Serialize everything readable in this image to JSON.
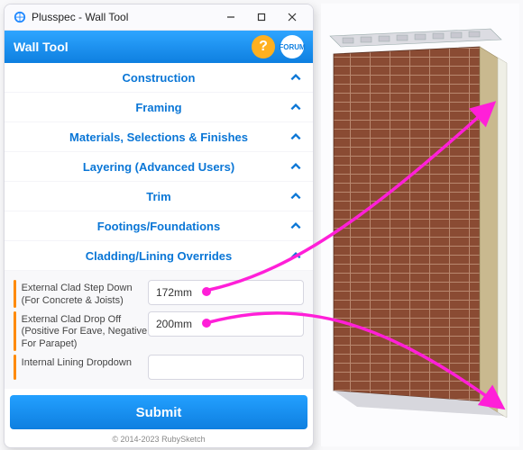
{
  "window": {
    "title": "Plusspec - Wall Tool"
  },
  "toolbar": {
    "title": "Wall Tool",
    "help_glyph": "?",
    "forum_label": "FORUM"
  },
  "sections": [
    {
      "label": "Construction"
    },
    {
      "label": "Framing"
    },
    {
      "label": "Materials, Selections & Finishes"
    },
    {
      "label": "Layering (Advanced Users)"
    },
    {
      "label": "Trim"
    },
    {
      "label": "Footings/Foundations"
    },
    {
      "label": "Cladding/Lining Overrides"
    }
  ],
  "overrides": {
    "step_down": {
      "label": "External Clad Step Down (For Concrete & Joists)",
      "value": "172mm"
    },
    "drop_off": {
      "label": "External Clad Drop Off (Positive For Eave, Negative For Parapet)",
      "value": "200mm"
    },
    "internal_lining": {
      "label": "Internal Lining Dropdown",
      "value": ""
    }
  },
  "submit": {
    "label": "Submit"
  },
  "footer": {
    "copyright": "© 2014-2023 RubySketch"
  },
  "colors": {
    "accent_blue": "#0e7fe0",
    "accent_orange": "#ff8a00",
    "annotation_magenta": "#ff1fd8",
    "brick": "#8a4b33"
  }
}
